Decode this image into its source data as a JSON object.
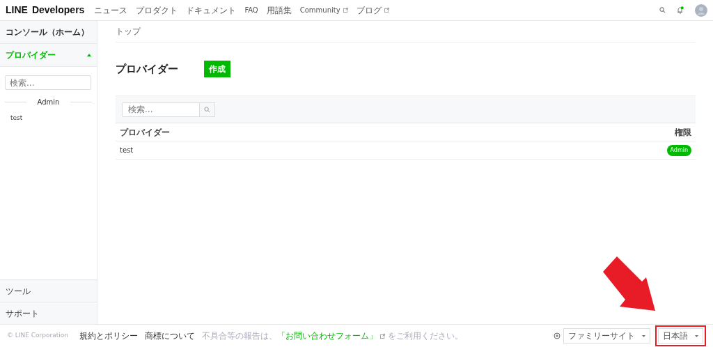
{
  "header": {
    "logo_mark": "LINE",
    "logo_text": "Developers",
    "nav": [
      {
        "label": "ニュース",
        "external": false
      },
      {
        "label": "プロダクト",
        "external": false
      },
      {
        "label": "ドキュメント",
        "external": false
      },
      {
        "label": "FAQ",
        "external": false
      },
      {
        "label": "用語集",
        "external": false
      },
      {
        "label": "Community",
        "external": true
      },
      {
        "label": "ブログ",
        "external": true
      }
    ],
    "notification": {
      "unread": true
    }
  },
  "sidebar": {
    "home": {
      "label": "コンソール（ホーム）"
    },
    "providers": {
      "label": "プロバイダー",
      "expanded": true,
      "search_placeholder": "検索...",
      "group": "Admin",
      "items": [
        "test"
      ]
    },
    "bottom": [
      "ツール",
      "サポート"
    ]
  },
  "main": {
    "breadcrumb": "トップ",
    "title": "プロバイダー",
    "create_button": "作成",
    "table": {
      "search_placeholder": "検索...",
      "columns": [
        "プロバイダー",
        "権限"
      ],
      "rows": [
        {
          "name": "test",
          "role": "Admin"
        }
      ]
    }
  },
  "footer": {
    "copyright": "© LINE Corporation",
    "links": [
      "規約とポリシー",
      "商標について"
    ],
    "notice": {
      "before": "不具合等の報告は、",
      "link": "「お問い合わせフォーム」",
      "after": "をご利用ください。"
    },
    "family_site": "ファミリーサイト",
    "language": "日本語"
  }
}
